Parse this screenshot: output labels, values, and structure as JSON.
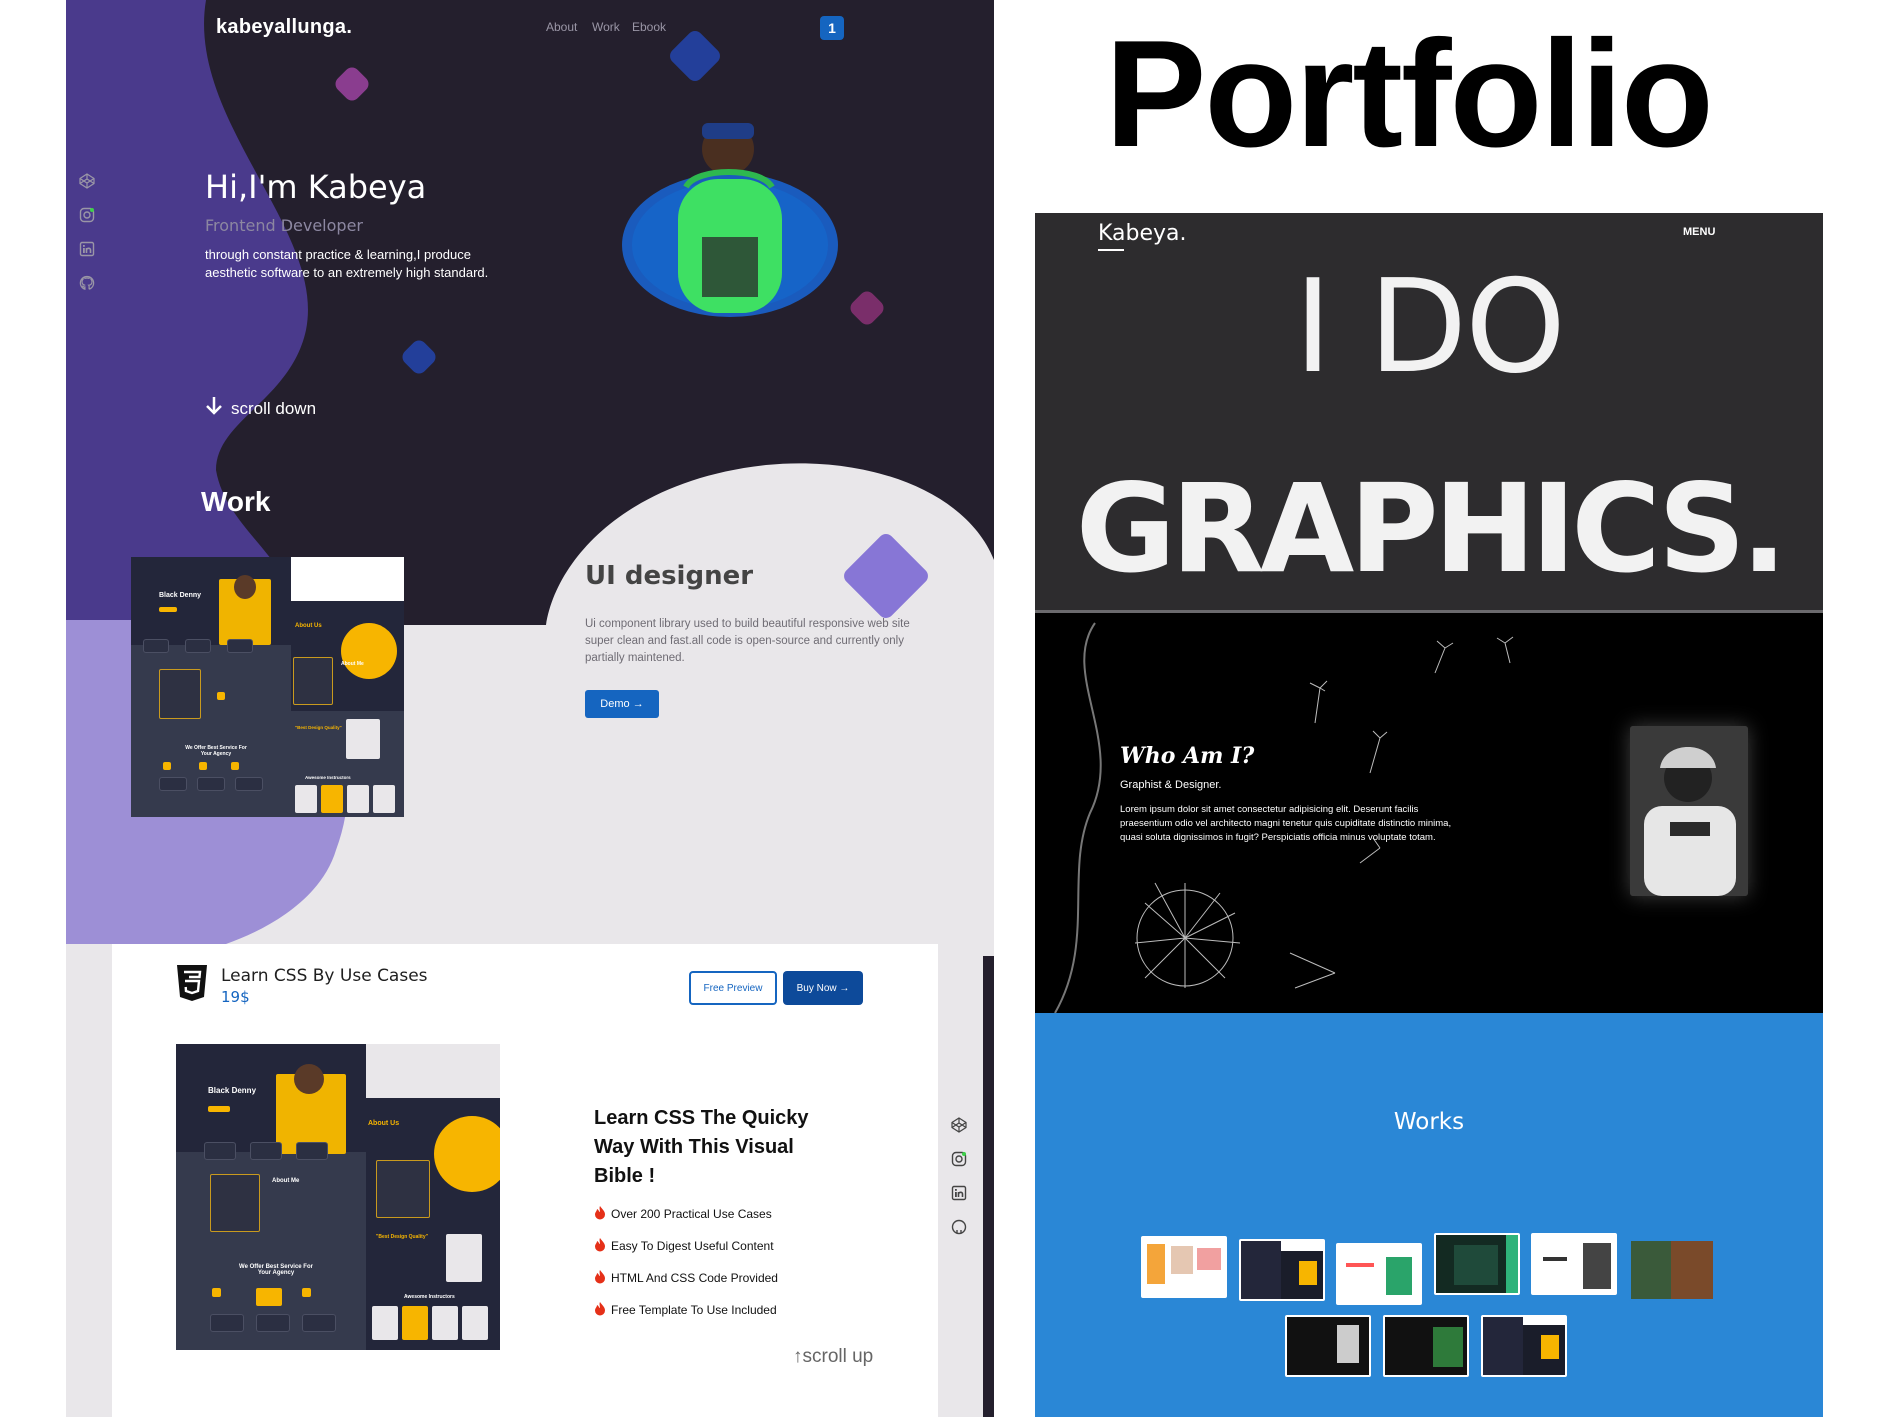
{
  "big_title": "Portfolio",
  "portfolio_site": {
    "logo": "kabeyallunga.",
    "nav": [
      "About",
      "Work",
      "Ebook"
    ],
    "nav_badge": "1",
    "hero": {
      "greeting": "Hi,I'm Kabeya",
      "role": "Frontend Developer",
      "description": "through constant practice & learning,I produce aesthetic software to an extremely high standard."
    },
    "scroll_down": "scroll down",
    "work_heading": "Work",
    "project": {
      "title": "UI designer",
      "description": "Ui component library used to build beautiful responsive web site super clean and fast.all code is open-source and currently only partially maintened.",
      "button": "Demo →"
    },
    "mockup": {
      "hero_name": "Black Denny",
      "about": "About Us",
      "about_me": "About Me",
      "services": "We Offer Best Service For Your Agency",
      "quality": "\"Best Design Quality\"",
      "instructors": "Awesome Instructors"
    }
  },
  "course": {
    "title": "Learn CSS By Use Cases",
    "price": "19$",
    "buttons": {
      "preview": "Free Preview",
      "buy": "Buy Now →"
    },
    "heading": "Learn CSS The Quicky Way With This Visual Bible !",
    "features": [
      "Over 200 Practical Use Cases",
      "Easy To Digest Useful Content",
      "HTML And CSS Code Provided",
      "Free Template To Use Included"
    ],
    "scroll_up": "↑scroll up"
  },
  "graphics_site": {
    "logo": "Kabeya.",
    "menu": "MENU",
    "line1": "I DO",
    "line2": "GRAPHICS.",
    "who_title": "Who Am I?",
    "who_sub": "Graphist & Designer.",
    "who_text": "Lorem ipsum dolor sit amet consectetur adipisicing elit. Deserunt facilis praesentium odio vel architecto magni tenetur quis cupiditate distinctio minima, quasi soluta dignissimos in fugit? Perspiciatis officia minus voluptate totam.",
    "works_title": "Works"
  },
  "colors": {
    "accent_blue": "#1565c0",
    "hero_purple": "#4a3a8c",
    "dark_bg": "#241f2d",
    "works_blue": "#2a87d6",
    "mock_yellow": "#f7b500"
  }
}
